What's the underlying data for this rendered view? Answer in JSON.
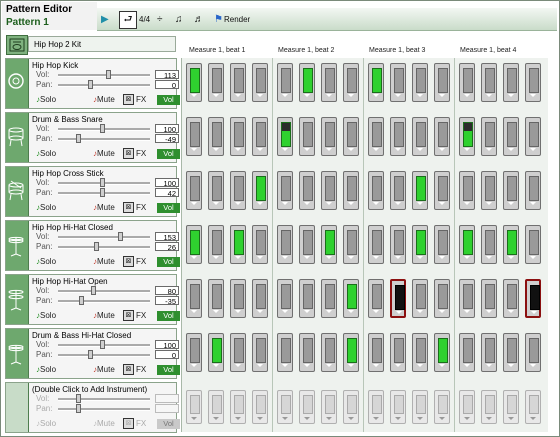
{
  "header": {
    "title": "Pattern Editor",
    "pattern_name": "Pattern 1"
  },
  "toolbar": {
    "items": [
      {
        "name": "play",
        "glyph": "▶",
        "color": "#1f8fa8"
      },
      {
        "name": "loop",
        "glyph": "⮐",
        "color": "#111111"
      },
      {
        "name": "time-signature",
        "glyph": "4/4",
        "color": "#111111"
      },
      {
        "name": "division",
        "glyph": "÷",
        "color": "#111111"
      },
      {
        "name": "notes",
        "glyph": "♫",
        "color": "#111111"
      },
      {
        "name": "notes-2",
        "glyph": "♬",
        "color": "#111111"
      }
    ],
    "render_label": "Render"
  },
  "kit": {
    "name": "Hip Hop 2 Kit"
  },
  "measures": [
    "Measure 1, beat 1",
    "Measure 1, beat 2",
    "Measure 1, beat 3",
    "Measure 1, beat 4"
  ],
  "labels": {
    "vol": "Vol:",
    "pan": "Pan:",
    "solo": "Solo",
    "mute": "Mute",
    "fx": "FX",
    "vol_btn": "Vol"
  },
  "tracks": [
    {
      "name": "Hip Hop Kick",
      "vol": "113",
      "pan": "0",
      "vol_level": 0.8,
      "pan_level": 0.5,
      "icon": "kick-drum-icon",
      "steps": [
        1,
        0,
        0,
        0,
        0,
        1,
        0,
        0,
        1,
        0,
        0,
        0,
        0,
        0,
        0,
        0
      ]
    },
    {
      "name": "Drum & Bass Snare",
      "vol": "100",
      "pan": "-49",
      "vol_level": 0.7,
      "pan_level": 0.3,
      "icon": "snare-drum-icon",
      "steps": [
        0,
        0,
        0,
        0,
        1,
        0,
        0,
        0,
        0,
        0,
        0,
        0,
        1,
        0,
        0,
        0
      ]
    },
    {
      "name": "Hip Hop Cross Stick",
      "vol": "100",
      "pan": "42",
      "vol_level": 0.7,
      "pan_level": 0.7,
      "icon": "cross-stick-icon",
      "steps": [
        0,
        0,
        0,
        1,
        0,
        0,
        0,
        0,
        0,
        0,
        1,
        0,
        0,
        0,
        0,
        0
      ]
    },
    {
      "name": "Hip Hop Hi-Hat Closed",
      "vol": "153",
      "pan": "26",
      "vol_level": 1.0,
      "pan_level": 0.6,
      "icon": "hihat-closed-icon",
      "steps": [
        1,
        0,
        1,
        0,
        0,
        0,
        1,
        0,
        0,
        0,
        1,
        0,
        1,
        0,
        1,
        0
      ]
    },
    {
      "name": "Hip Hop Hi-Hat Open",
      "vol": "80",
      "pan": "-35",
      "vol_level": 0.55,
      "pan_level": 0.35,
      "icon": "hihat-open-icon",
      "steps": [
        0,
        0,
        0,
        0,
        0,
        0,
        0,
        1,
        0,
        2,
        0,
        0,
        0,
        0,
        0,
        2
      ]
    },
    {
      "name": "Drum & Bass Hi-Hat Closed",
      "vol": "100",
      "pan": "0",
      "vol_level": 0.7,
      "pan_level": 0.5,
      "icon": "hihat-closed-icon",
      "steps": [
        0,
        1,
        0,
        0,
        0,
        0,
        0,
        1,
        0,
        0,
        0,
        1,
        0,
        0,
        0,
        0
      ]
    },
    {
      "name": "(Double Click to Add Instrument)",
      "vol": "",
      "pan": "",
      "vol_level": 0.3,
      "pan_level": 0.3,
      "icon": "empty-slot-icon",
      "empty": true,
      "steps": [
        0,
        0,
        0,
        0,
        0,
        0,
        0,
        0,
        0,
        0,
        0,
        0,
        0,
        0,
        0,
        0
      ]
    }
  ],
  "colors": {
    "active_step": "#2fd12f",
    "accent_step": "#8b1010",
    "track_icon_bg": "#6ea86e",
    "vol_button": "#2f8f2f"
  }
}
